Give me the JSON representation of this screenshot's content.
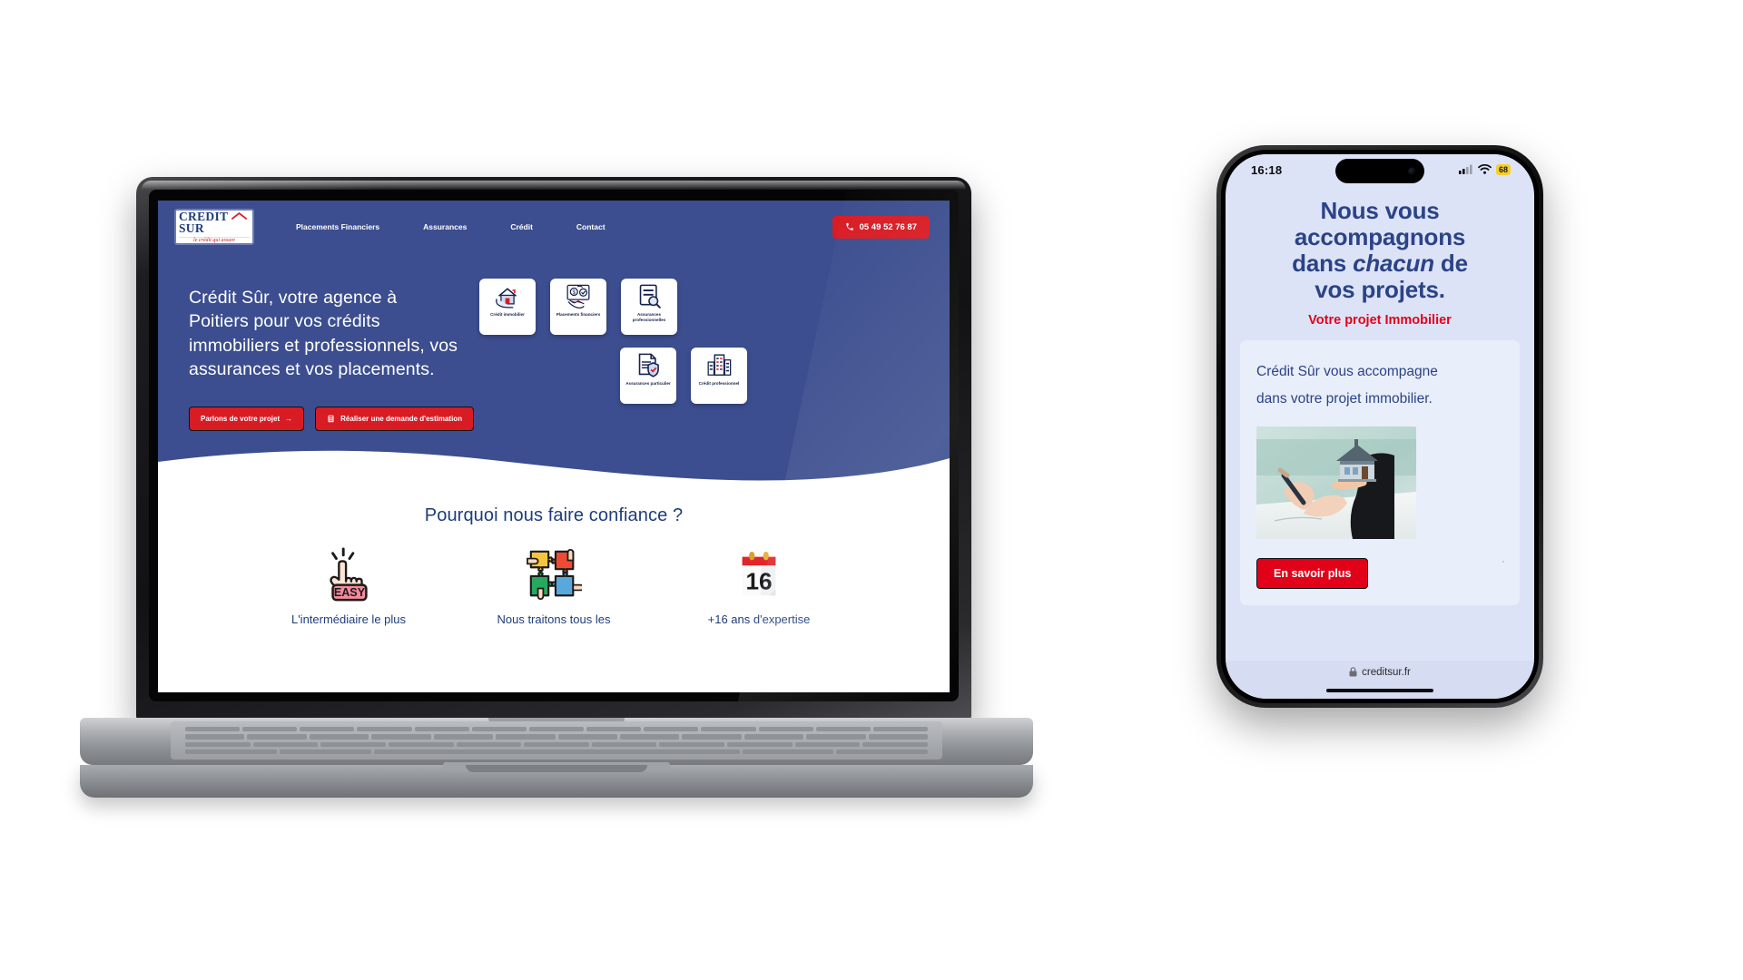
{
  "desktop": {
    "nav": {
      "logo": {
        "main": "CREDIT SUR",
        "tagline": "le crédit qui assure"
      },
      "links": [
        {
          "label": "Placements Financiers"
        },
        {
          "label": "Assurances"
        },
        {
          "label": "Crédit"
        },
        {
          "label": "Contact"
        }
      ],
      "phone_label": "05 49 52 76 87"
    },
    "hero": {
      "heading": "Crédit Sûr, votre agence à Poitiers pour vos crédits immobiliers et professionnels, vos assurances et vos placements.",
      "cta_primary": "Parlons de votre projet",
      "cta_primary_arrow": "→",
      "cta_secondary": "Réaliser une demande d'estimation",
      "cards_row1": [
        {
          "label": "Crédit immobilier",
          "icon": "house-in-hand-icon"
        },
        {
          "label": "Placements financiers",
          "icon": "money-handshake-icon"
        },
        {
          "label": "Assurances professionnelles",
          "icon": "document-search-icon"
        }
      ],
      "cards_row2": [
        {
          "label": "Assurances particulier",
          "icon": "document-shield-icon"
        },
        {
          "label": "Crédit professionnel",
          "icon": "buildings-icon"
        }
      ]
    },
    "trust": {
      "heading": "Pourquoi nous faire confiance ?",
      "features": [
        {
          "label": "L'intermédiaire le plus",
          "icon": "easy-click-hand-icon"
        },
        {
          "label": "Nous traitons tous les",
          "icon": "puzzle-hands-icon"
        },
        {
          "label": "+16 ans d'expertise",
          "icon": "calendar-16-icon"
        }
      ]
    }
  },
  "mobile": {
    "status": {
      "time": "16:18",
      "battery": "68"
    },
    "heading_line1": "Nous vous",
    "heading_line2": "accompagnons",
    "heading_line3_a": "dans ",
    "heading_line3_em": "chacun",
    "heading_line3_b": " de",
    "heading_line4": "vos projets.",
    "subheading": "Votre projet Immobilier",
    "card_text_line1": "Crédit Sûr vous accompagne",
    "card_text_line2": "dans votre projet immobilier.",
    "card_image_alt": "hand-holding-house-photo",
    "ellipsis": "·",
    "button": "En savoir plus",
    "url": "creditsur.fr"
  },
  "colors": {
    "brand_blue": "#3c4e8f",
    "deep_blue": "#1f3d7a",
    "brand_red": "#d81c24",
    "mobile_red": "#e1021a",
    "mobile_bg": "#dde3f7"
  }
}
